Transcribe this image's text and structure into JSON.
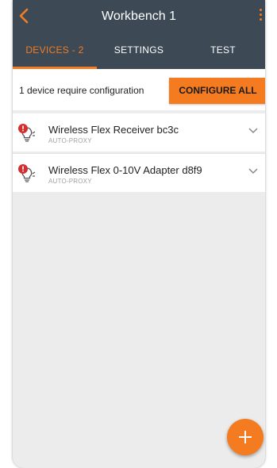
{
  "header": {
    "title": "Workbench 1",
    "back_icon": "chevron-left-icon",
    "menu_icon": "more-vert-icon"
  },
  "tabs": [
    {
      "label": "DEVICES - 2",
      "active": true
    },
    {
      "label": "SETTINGS",
      "active": false
    },
    {
      "label": "TEST",
      "active": false
    }
  ],
  "config": {
    "message": "1 device require configuration",
    "button_label": "CONFIGURE ALL"
  },
  "devices": [
    {
      "name": "Wireless Flex Receiver bc3c",
      "subtitle": "AUTO-PROXY",
      "icon": "bulb-alert-icon"
    },
    {
      "name": "Wireless Flex 0-10V Adapter  d8f9",
      "subtitle": "AUTO-PROXY",
      "icon": "bulb-alert-icon"
    }
  ],
  "fab": {
    "icon": "plus-icon"
  },
  "colors": {
    "appbar": "#3d4a56",
    "accent": "#f47b20",
    "background": "#ececec",
    "alert": "#d32f2f"
  }
}
